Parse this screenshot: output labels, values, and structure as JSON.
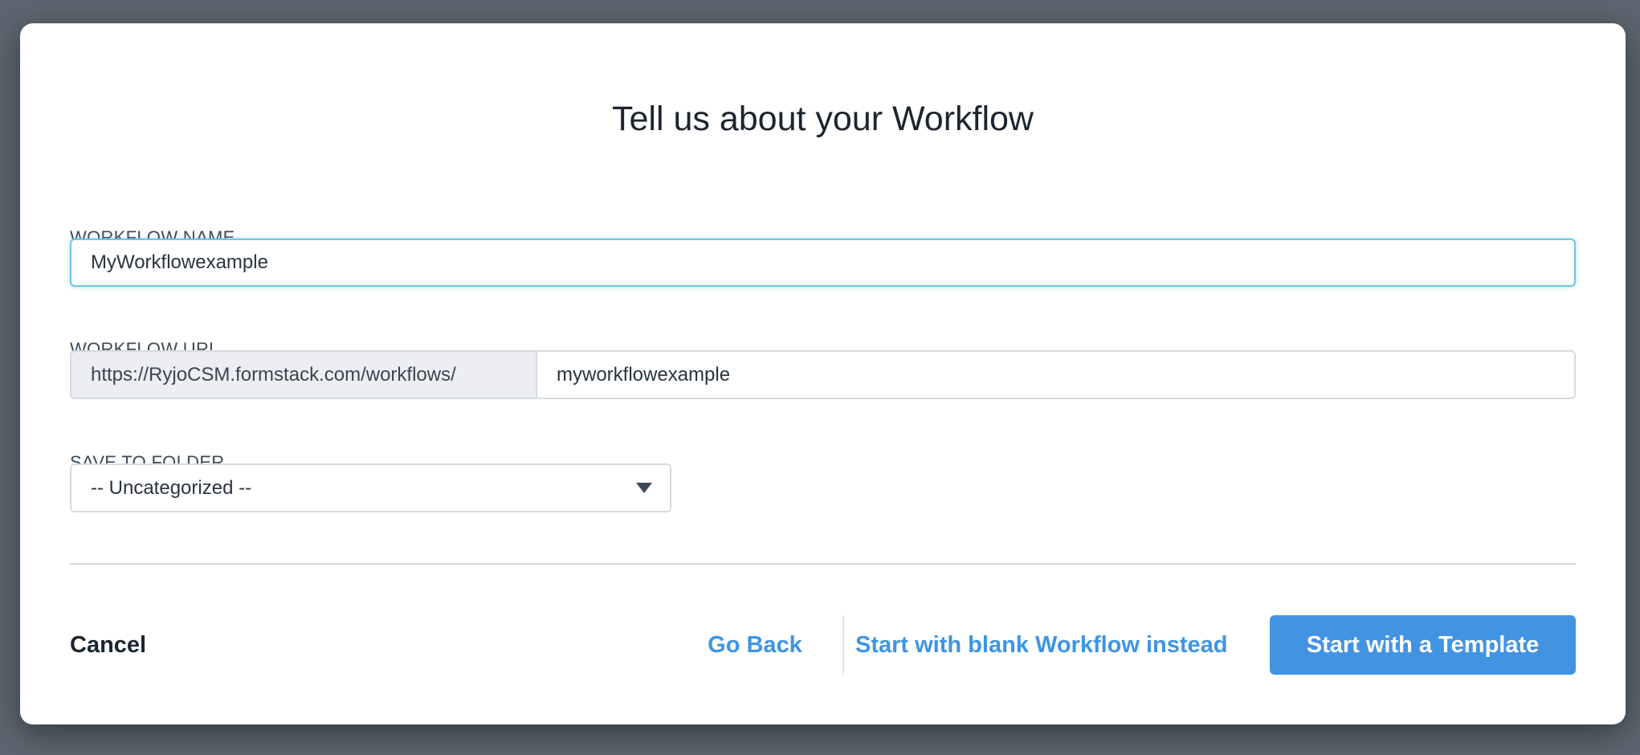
{
  "dialog": {
    "title": "Tell us about your Workflow",
    "workflow_name": {
      "label": "WORKFLOW NAME",
      "value": "MyWorkflowexample"
    },
    "workflow_url": {
      "label": "WORKFLOW URL",
      "prefix": "https://RyjoCSM.formstack.com/workflows/",
      "value": "myworkflowexample"
    },
    "save_to_folder": {
      "label": "SAVE TO FOLDER",
      "selected": "-- Uncategorized --"
    },
    "buttons": {
      "cancel": "Cancel",
      "go_back": "Go Back",
      "blank": "Start with blank Workflow instead",
      "template": "Start with a Template"
    }
  },
  "colors": {
    "accent": "#4294e3",
    "focus": "#6cc7e6"
  }
}
